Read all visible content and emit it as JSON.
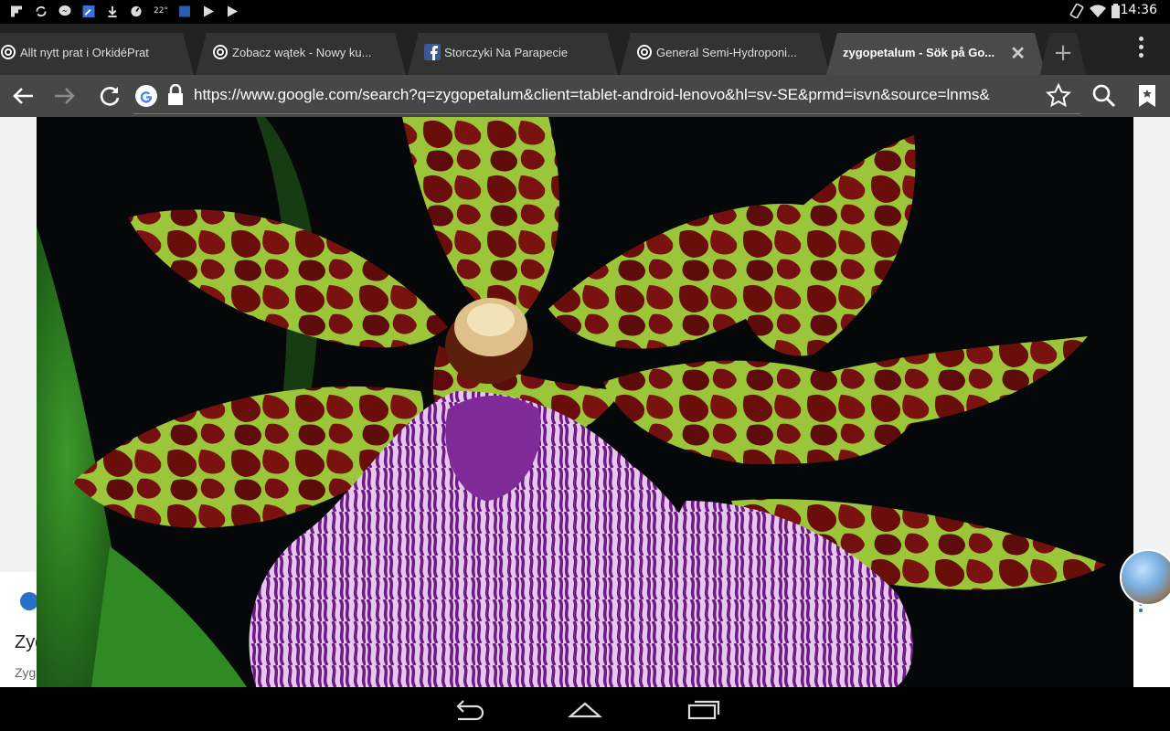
{
  "status_bar": {
    "time": "14:36",
    "temperature": "22°",
    "calendar_day": "31",
    "left_icons": [
      "flipboard-icon",
      "sync-icon",
      "messenger-icon",
      "wrench-app-icon",
      "download-icon",
      "speed-icon",
      "weather-icon",
      "calendar-icon",
      "play-store-icon",
      "play-store-icon"
    ],
    "right_icons": [
      "rotation-icon",
      "wifi-icon",
      "battery-icon"
    ]
  },
  "tabs": [
    {
      "label": "Allt nytt prat i OrkidéPrat",
      "icon": "site-favicon-icon"
    },
    {
      "label": "Zobacz wątek - Nowy ku...",
      "icon": "site-favicon-icon"
    },
    {
      "label": "Storczyki Na Parapecie",
      "icon": "facebook-icon"
    },
    {
      "label": "General Semi-Hydroponi...",
      "icon": "site-favicon-icon"
    },
    {
      "label": "zygopetalum - Sök på Go...",
      "active": true
    }
  ],
  "toolbar": {
    "url": "https://www.google.com/search?q=zygopetalum&client=tablet-android-lenovo&hl=sv-SE&prmd=isvn&source=lnms&"
  },
  "page": {
    "result_title_partial": "Zyg",
    "result_sub_partial": "Zyg"
  },
  "colors": {
    "tab_strip": "#222222",
    "active_tab": "#4a4a4a",
    "toolbar": "#474747",
    "accent_blue": "#2a6fc9"
  }
}
